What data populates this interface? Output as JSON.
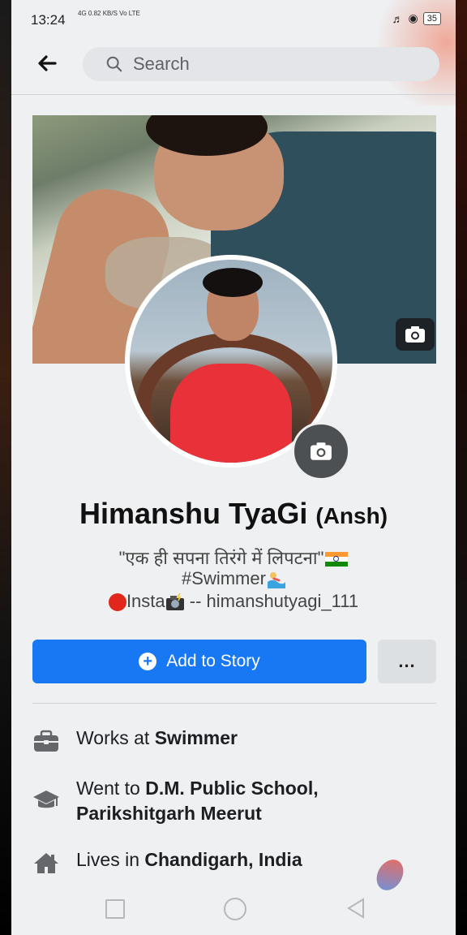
{
  "status_bar": {
    "time": "13:24",
    "network": "4G",
    "speed": "0.82 KB/S",
    "carrier": "Vo LTE",
    "battery": "35"
  },
  "header": {
    "back_icon": "back-arrow-icon",
    "search_placeholder": "Search"
  },
  "profile": {
    "name": "Himanshu TyaGi",
    "nickname": "(Ansh)",
    "bio_line1": "\"एक ही सपना तिरंगे में लिपटना\"",
    "bio_line2": "#Swimmer",
    "bio_line3_prefix": "Insta",
    "bio_line3_handle": " -- himanshutyagi_111"
  },
  "actions": {
    "add_story_label": "Add to Story",
    "more_label": "..."
  },
  "details": {
    "work_prefix": "Works at ",
    "work_place": "Swimmer",
    "edu_prefix": "Went to ",
    "edu_place": "D.M. Public School,",
    "edu_place2": "Parikshitgarh Meerut",
    "lives_prefix": "Lives in ",
    "lives_place": "Chandigarh, India"
  },
  "colors": {
    "accent": "#1877f2",
    "text": "#1c1e21"
  }
}
